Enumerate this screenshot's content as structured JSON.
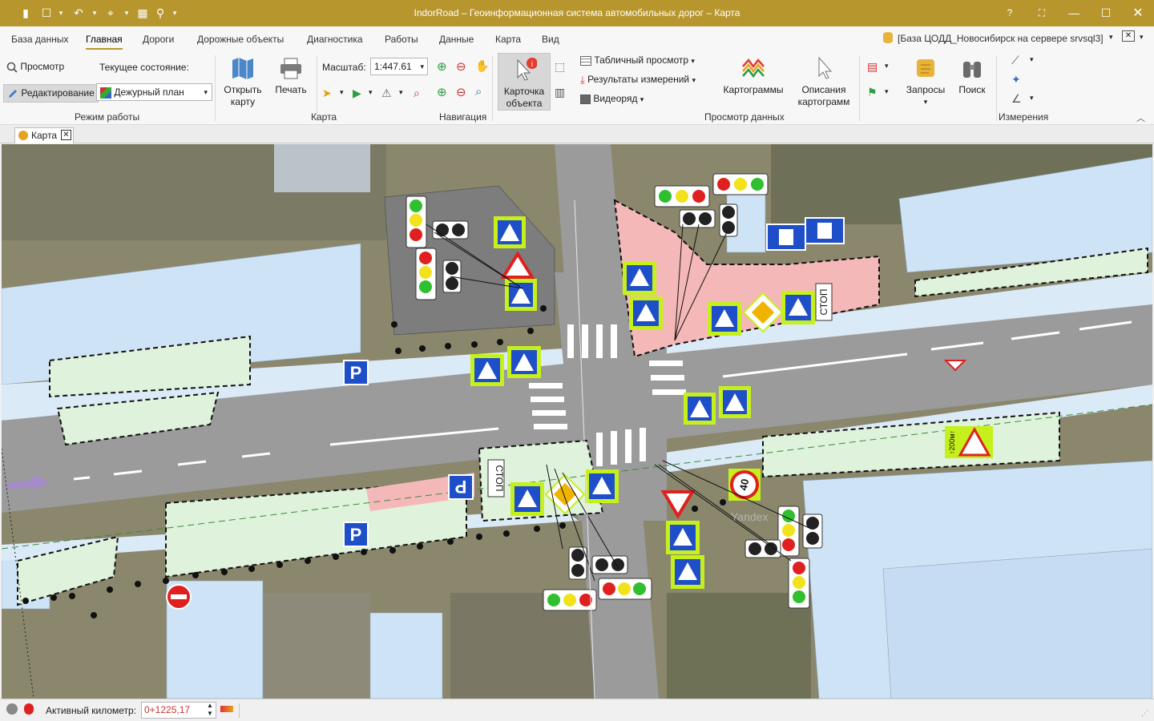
{
  "window": {
    "title": "IndorRoad – Геоинформационная система автомобильных дорог – Карта"
  },
  "menu": {
    "items": [
      "База данных",
      "Главная",
      "Дороги",
      "Дорожные объекты",
      "Диагностика",
      "Работы",
      "Данные",
      "Карта",
      "Вид"
    ],
    "active": "Главная",
    "database": "[База ЦОДД_Новосибирск  на сервере srvsql3]"
  },
  "ribbon": {
    "mode": {
      "view": "Просмотр",
      "current_state_label": "Текущее состояние:",
      "edit": "Редактирование",
      "state_value": "Дежурный план",
      "group_label": "Режим работы"
    },
    "map": {
      "open_line1": "Открыть",
      "open_line2": "карту",
      "print": "Печать",
      "group_label": "Карта"
    },
    "navigation": {
      "scale_label": "Масштаб:",
      "scale_value": "1:447.61",
      "group_label": "Навигация"
    },
    "data_view": {
      "card_line1": "Карточка",
      "card_line2": "объекта",
      "table_view": "Табличный просмотр",
      "measure_results": "Результаты измерений",
      "video": "Видеоряд",
      "cartograms": "Картограммы",
      "desc_line1": "Описания",
      "desc_line2": "картограмм",
      "group_label": "Просмотр данных"
    },
    "queries": "Запросы",
    "search": "Поиск",
    "measurements": {
      "group_label": "Измерения"
    }
  },
  "tabs": {
    "map_tab": "Карта"
  },
  "map": {
    "stop_label": "СТОП",
    "speed_limit": "40",
    "distance_plate": "↑200м↑",
    "watermark": "Yandex"
  },
  "status": {
    "active_km_label": "Активный километр:",
    "active_km_value": "0+1225,17"
  },
  "colors": {
    "titlebar": "#b8962e",
    "road": "#9b9b9b",
    "building": "#cfe3f7",
    "greenzone": "#dff2dc",
    "crossing_zone": "#f5b8b8"
  }
}
